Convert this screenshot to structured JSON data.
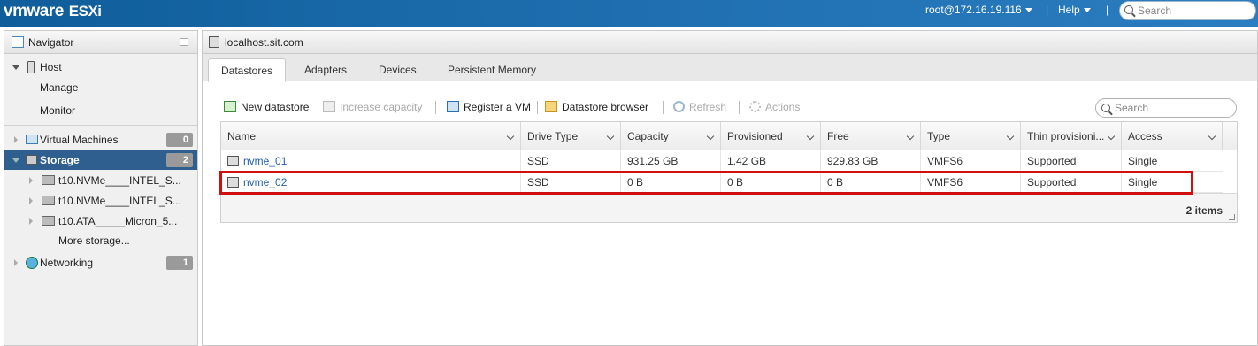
{
  "topbar": {
    "brand": "vmware",
    "product": "ESXi",
    "user": "root@172.16.19.116",
    "help": "Help",
    "separator": "|",
    "search_placeholder": "Search"
  },
  "navigator": {
    "title": "Navigator",
    "host": {
      "label": "Host",
      "children": [
        "Manage",
        "Monitor"
      ]
    },
    "virtual_machines": {
      "label": "Virtual Machines",
      "count": "0"
    },
    "storage": {
      "label": "Storage",
      "count": "2",
      "devices": [
        "t10.NVMe____INTEL_S...",
        "t10.NVMe____INTEL_S...",
        "t10.ATA_____Micron_5..."
      ],
      "more": "More storage..."
    },
    "networking": {
      "label": "Networking",
      "count": "1"
    }
  },
  "main": {
    "title": "localhost.sit.com",
    "tabs": [
      "Datastores",
      "Adapters",
      "Devices",
      "Persistent Memory"
    ],
    "active_tab": "Datastores"
  },
  "toolbar": {
    "new_datastore": "New datastore",
    "increase_capacity": "Increase capacity",
    "register_vm": "Register a VM",
    "datastore_browser": "Datastore browser",
    "refresh": "Refresh",
    "actions": "Actions",
    "search_placeholder": "Search"
  },
  "grid": {
    "columns": [
      "Name",
      "Drive Type",
      "Capacity",
      "Provisioned",
      "Free",
      "Type",
      "Thin provisioni...",
      "Access"
    ],
    "rows": [
      {
        "name": "nvme_01",
        "drive_type": "SSD",
        "capacity": "931.25 GB",
        "provisioned": "1.42 GB",
        "free": "929.83 GB",
        "type": "VMFS6",
        "thin": "Supported",
        "access": "Single"
      },
      {
        "name": "nvme_02",
        "drive_type": "SSD",
        "capacity": "0 B",
        "provisioned": "0 B",
        "free": "0 B",
        "type": "VMFS6",
        "thin": "Supported",
        "access": "Single"
      }
    ],
    "item_count": "2 items",
    "highlighted_row": "nvme_02"
  },
  "colors": {
    "topbar": "#1f6fb0",
    "selected_nav": "#2e5f8e",
    "highlight": "#d01010",
    "link": "#2460a7"
  }
}
